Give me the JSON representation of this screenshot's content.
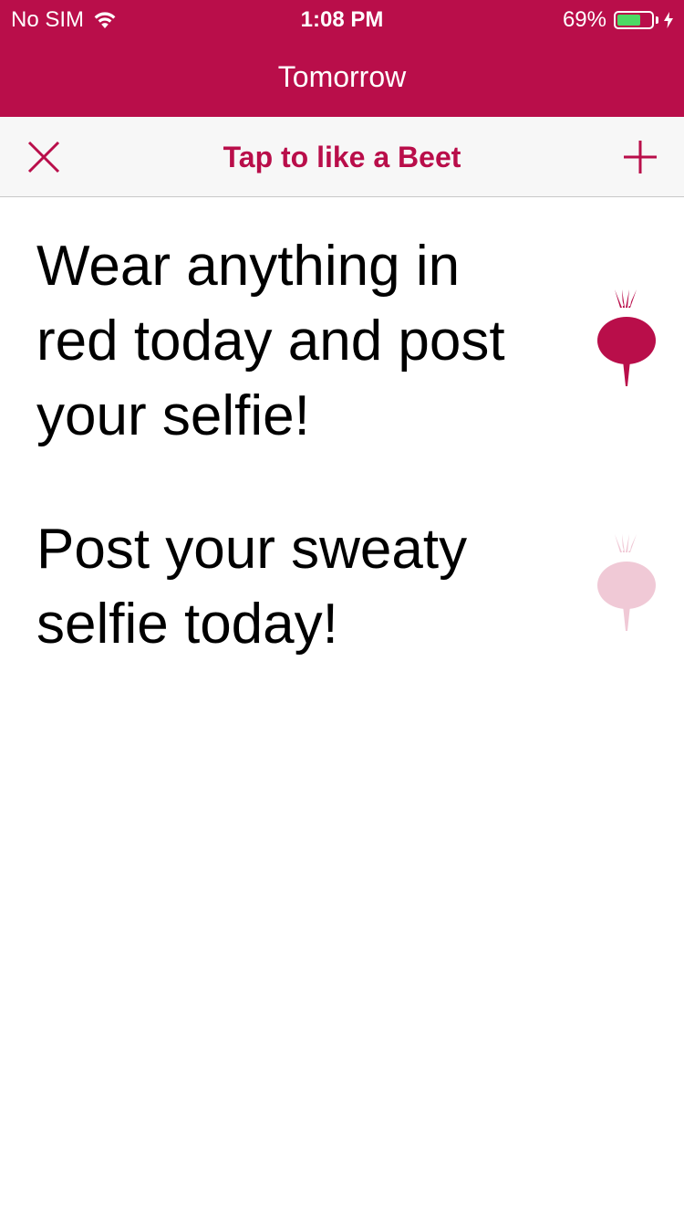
{
  "status_bar": {
    "carrier": "No SIM",
    "time": "1:08 PM",
    "battery_percent": "69%",
    "battery_level": 0.69
  },
  "nav": {
    "title": "Tomorrow"
  },
  "toolbar": {
    "close_icon": "close-icon",
    "title": "Tap to like a Beet",
    "add_icon": "plus-icon"
  },
  "colors": {
    "brand": "#b90e4a",
    "beet_liked": "#b90e4a",
    "beet_unliked": "#f0c9d6",
    "battery": "#4cd964"
  },
  "challenges": [
    {
      "text": "Wear anything in red today and post your selfie!",
      "liked": true
    },
    {
      "text": "Post your sweaty selfie today!",
      "liked": false
    }
  ]
}
